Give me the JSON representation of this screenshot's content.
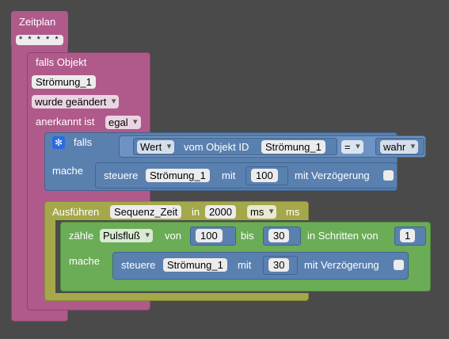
{
  "zeitplan": {
    "label": "Zeitplan",
    "schedule": "* * * * *"
  },
  "on_change": {
    "title": "falls Objekt",
    "object": "Strömung_1",
    "change": "wurde geändert",
    "ack_label": "anerkannt ist",
    "ack_value": "egal"
  },
  "if_block": {
    "if_label": "falls",
    "then_label": "mache",
    "value_dd": "Wert",
    "from_object_label": "vom Objekt ID",
    "object": "Strömung_1",
    "operator": "=",
    "compare_value": "wahr"
  },
  "control1": {
    "label": "steuere",
    "object": "Strömung_1",
    "with_label": "mit",
    "value": "100",
    "delay_label": "mit Verzögerung"
  },
  "execute": {
    "label": "Ausführen",
    "name": "Sequenz_Zeit",
    "in_label": "in",
    "time": "2000",
    "unit_dd": "ms",
    "unit_text": "ms"
  },
  "loop": {
    "count_label": "zähle",
    "var": "Pulsfluß",
    "from_label": "von",
    "from": "100",
    "to_label": "bis",
    "to": "30",
    "step_label": "in Schritten von",
    "step": "1",
    "do_label": "mache"
  },
  "control2": {
    "label": "steuere",
    "object": "Strömung_1",
    "with_label": "mit",
    "value": "30",
    "delay_label": "mit Verzögerung"
  }
}
